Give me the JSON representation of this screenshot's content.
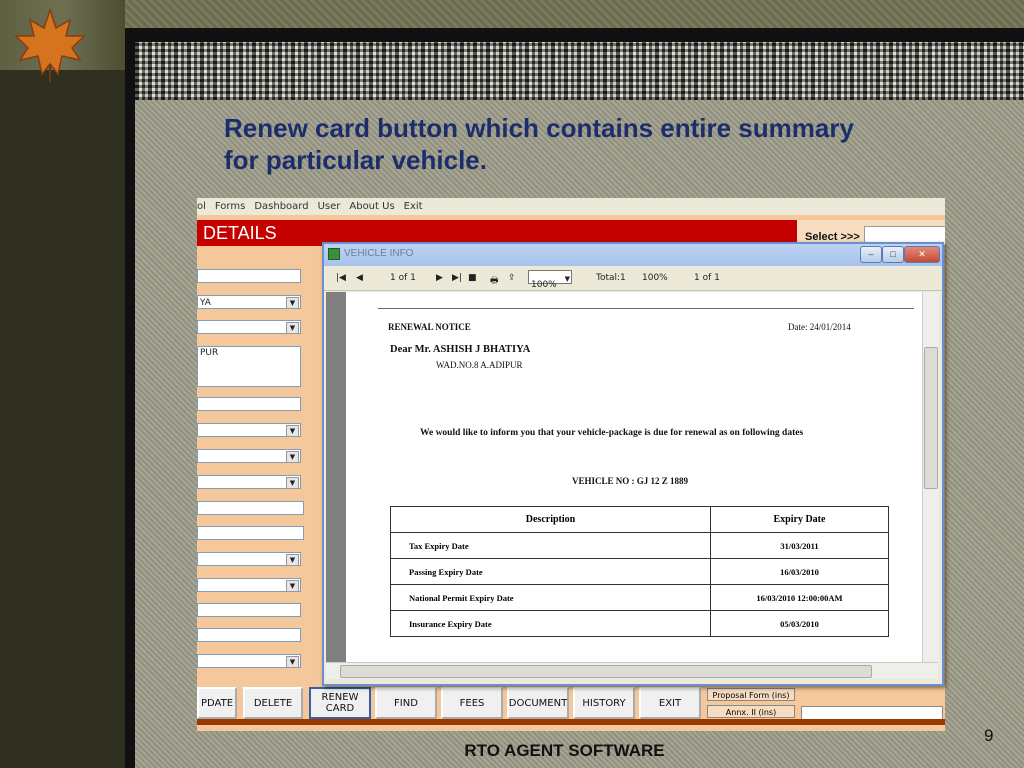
{
  "slide": {
    "heading_line1": "Renew card button which contains entire summary",
    "heading_line2": "for particular  vehicle.",
    "footer": "RTO  AGENT SOFTWARE",
    "page_number": "9"
  },
  "app": {
    "menu": [
      "ol",
      "Forms",
      "Dashboard",
      "User",
      "About Us",
      "Exit"
    ],
    "header_title": "DETAILS",
    "select_label": "Select >>>",
    "fields": {
      "f2": "YA",
      "f4": "PUR"
    },
    "buttons": {
      "update": "PDATE",
      "delete": "DELETE",
      "renew_card": "RENEW\nCARD",
      "find": "FIND",
      "fees": "FEES",
      "document": "DOCUMENT",
      "history": "HISTORY",
      "exit": "EXIT",
      "proposal_form": "Proposal Form (ins)",
      "annx": "Annx. II (ins)"
    }
  },
  "viewer": {
    "title": "VEHICLE INFO",
    "toolbar": {
      "page_of": "1 of 1",
      "zoom": "100%",
      "total": "Total:1",
      "percent": "100%",
      "page_of_right": "1 of 1"
    },
    "report": {
      "notice_title": "RENEWAL NOTICE",
      "date": "Date: 24/01/2014",
      "salutation": "Dear Mr. ASHISH J BHATIYA",
      "address": "WAD.NO.8 A.ADIPUR",
      "message": "We would like to inform you that your vehicle-package is due for renewal as on following dates",
      "vehicle_no": "VEHICLE NO :  GJ 12 Z 1889",
      "table_headers": [
        "Description",
        "Expiry Date"
      ],
      "rows": [
        {
          "desc": "Tax Expiry Date",
          "date": "31/03/2011"
        },
        {
          "desc": "Passing Expiry Date",
          "date": "16/03/2010"
        },
        {
          "desc": "National Permit  Expiry Date",
          "date": "16/03/2010  12:00:00AM"
        },
        {
          "desc": "Insurance Expiry Date",
          "date": "05/03/2010"
        }
      ]
    }
  }
}
